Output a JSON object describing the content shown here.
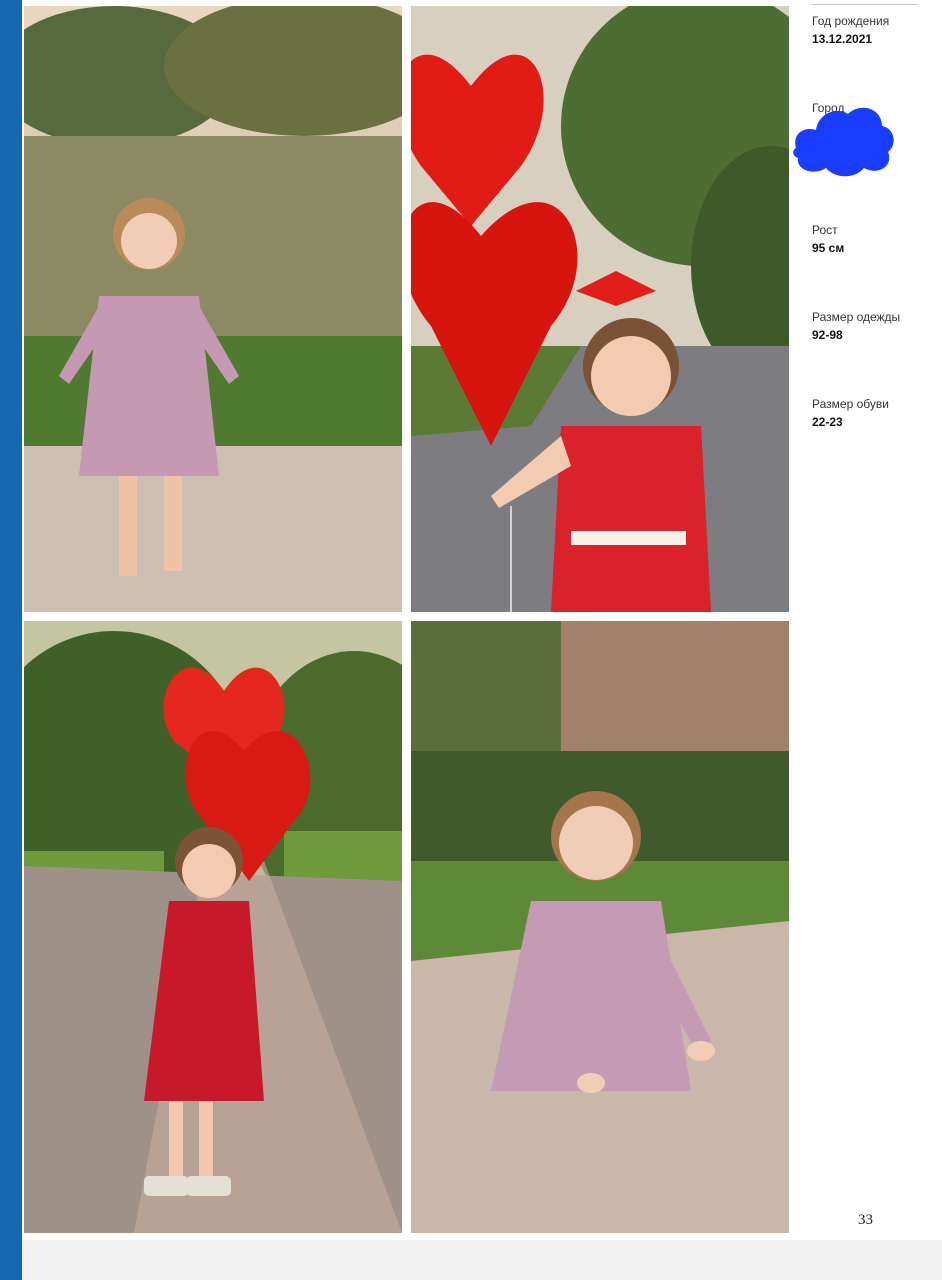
{
  "profile": {
    "birth_label": "Год рождения",
    "birth_value": "13.12.2021",
    "city_label": "Город",
    "height_label": "Рост",
    "height_value": "95 см",
    "clothes_label": "Размер одежды",
    "clothes_value": "92-98",
    "shoes_label": "Размер обуви",
    "shoes_value": "22-23"
  },
  "page_number": "33",
  "colors": {
    "accent_bar": "#1467b0",
    "redaction": "#1a3cff"
  }
}
